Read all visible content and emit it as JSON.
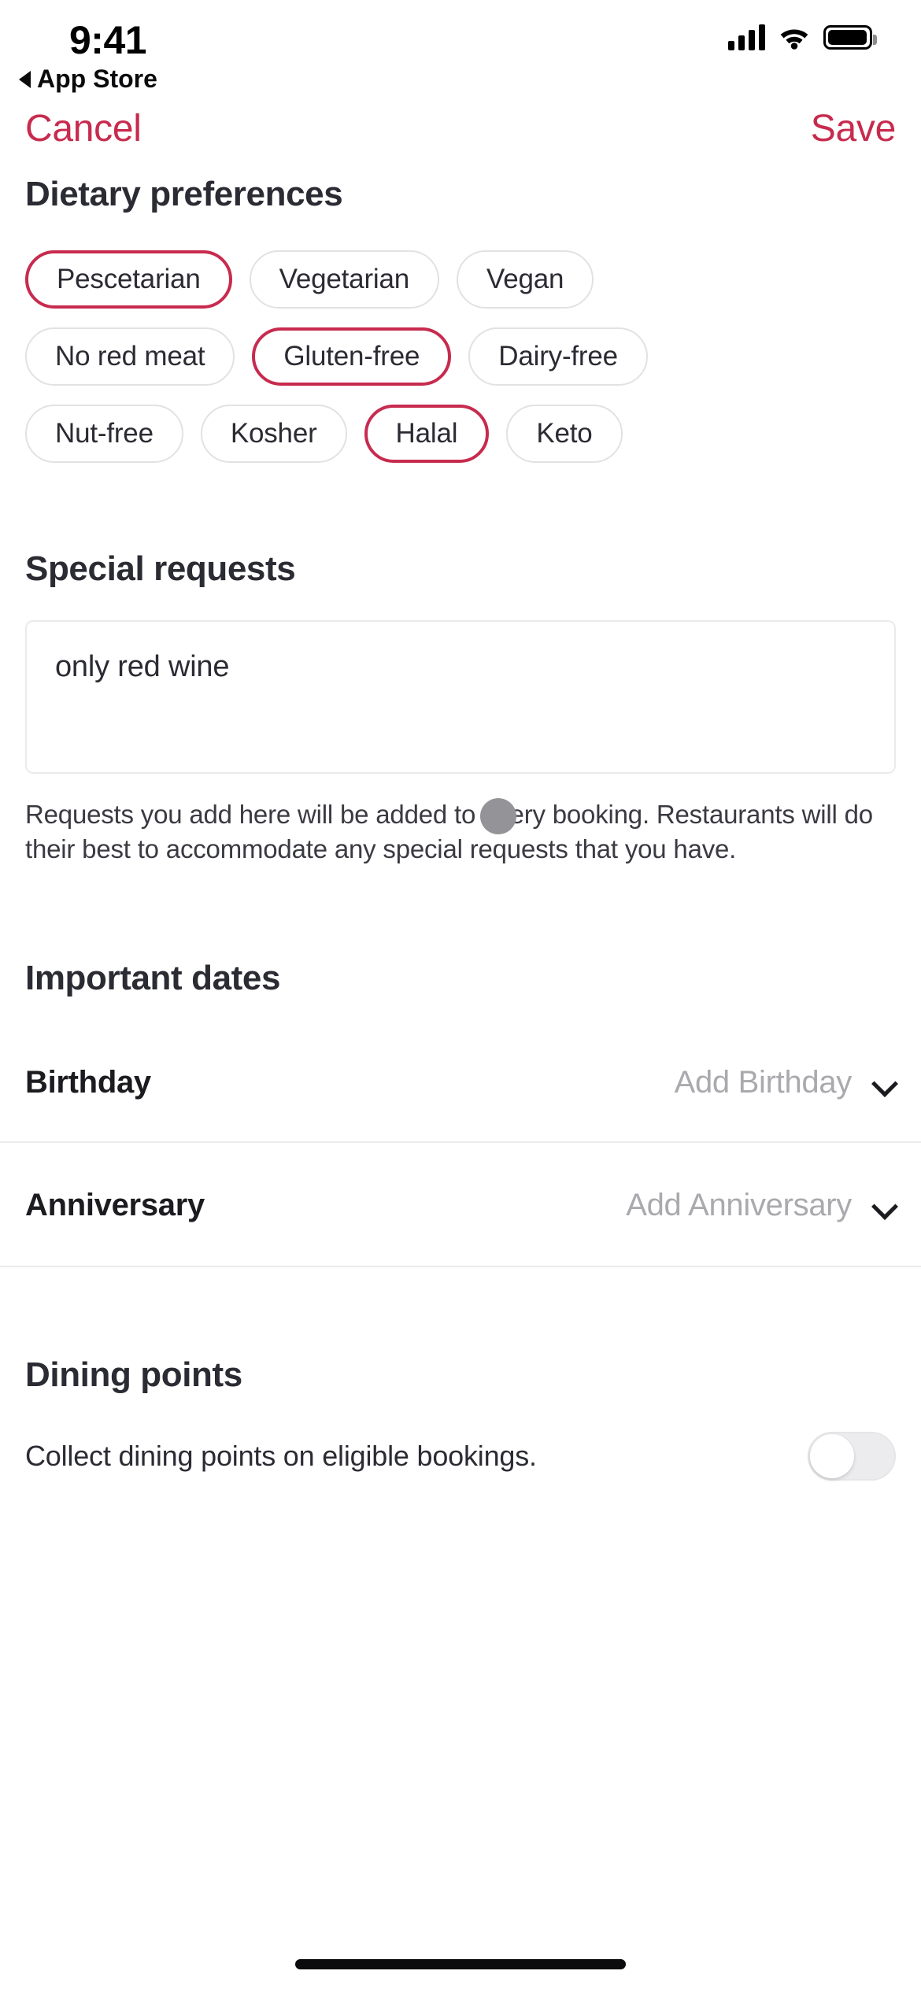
{
  "status_bar": {
    "time": "9:41",
    "back_app_label": "App Store",
    "back_caret_icon": "triangle-left-icon",
    "cellular_icon": "cellular-bars-icon",
    "wifi_icon": "wifi-icon",
    "battery_icon": "battery-full-icon"
  },
  "nav": {
    "cancel_label": "Cancel",
    "save_label": "Save",
    "accent_color": "#c72b4e"
  },
  "dietary": {
    "title": "Dietary preferences",
    "chips": [
      {
        "label": "Pescetarian",
        "selected": true
      },
      {
        "label": "Vegetarian",
        "selected": false
      },
      {
        "label": "Vegan",
        "selected": false
      },
      {
        "label": "No red meat",
        "selected": false
      },
      {
        "label": "Gluten-free",
        "selected": true
      },
      {
        "label": "Dairy-free",
        "selected": false
      },
      {
        "label": "Nut-free",
        "selected": false
      },
      {
        "label": "Kosher",
        "selected": false
      },
      {
        "label": "Halal",
        "selected": true
      },
      {
        "label": "Keto",
        "selected": false
      }
    ]
  },
  "special_requests": {
    "title": "Special requests",
    "value": "only red wine",
    "placeholder": "",
    "helper_text": "Requests you add here will be added to every booking. Restaurants will do their best to accommodate any special requests that you have."
  },
  "important_dates": {
    "title": "Important dates",
    "rows": [
      {
        "label": "Birthday",
        "value": "Add Birthday",
        "chevron_icon": "chevron-down-icon"
      },
      {
        "label": "Anniversary",
        "value": "Add Anniversary",
        "chevron_icon": "chevron-down-icon"
      }
    ]
  },
  "dining_points": {
    "title": "Dining points",
    "description": "Collect dining points on eligible bookings.",
    "toggle_on": false
  },
  "cursor": {
    "icon": "touch-cursor-icon"
  },
  "home_indicator": {
    "icon": "home-indicator-icon"
  }
}
